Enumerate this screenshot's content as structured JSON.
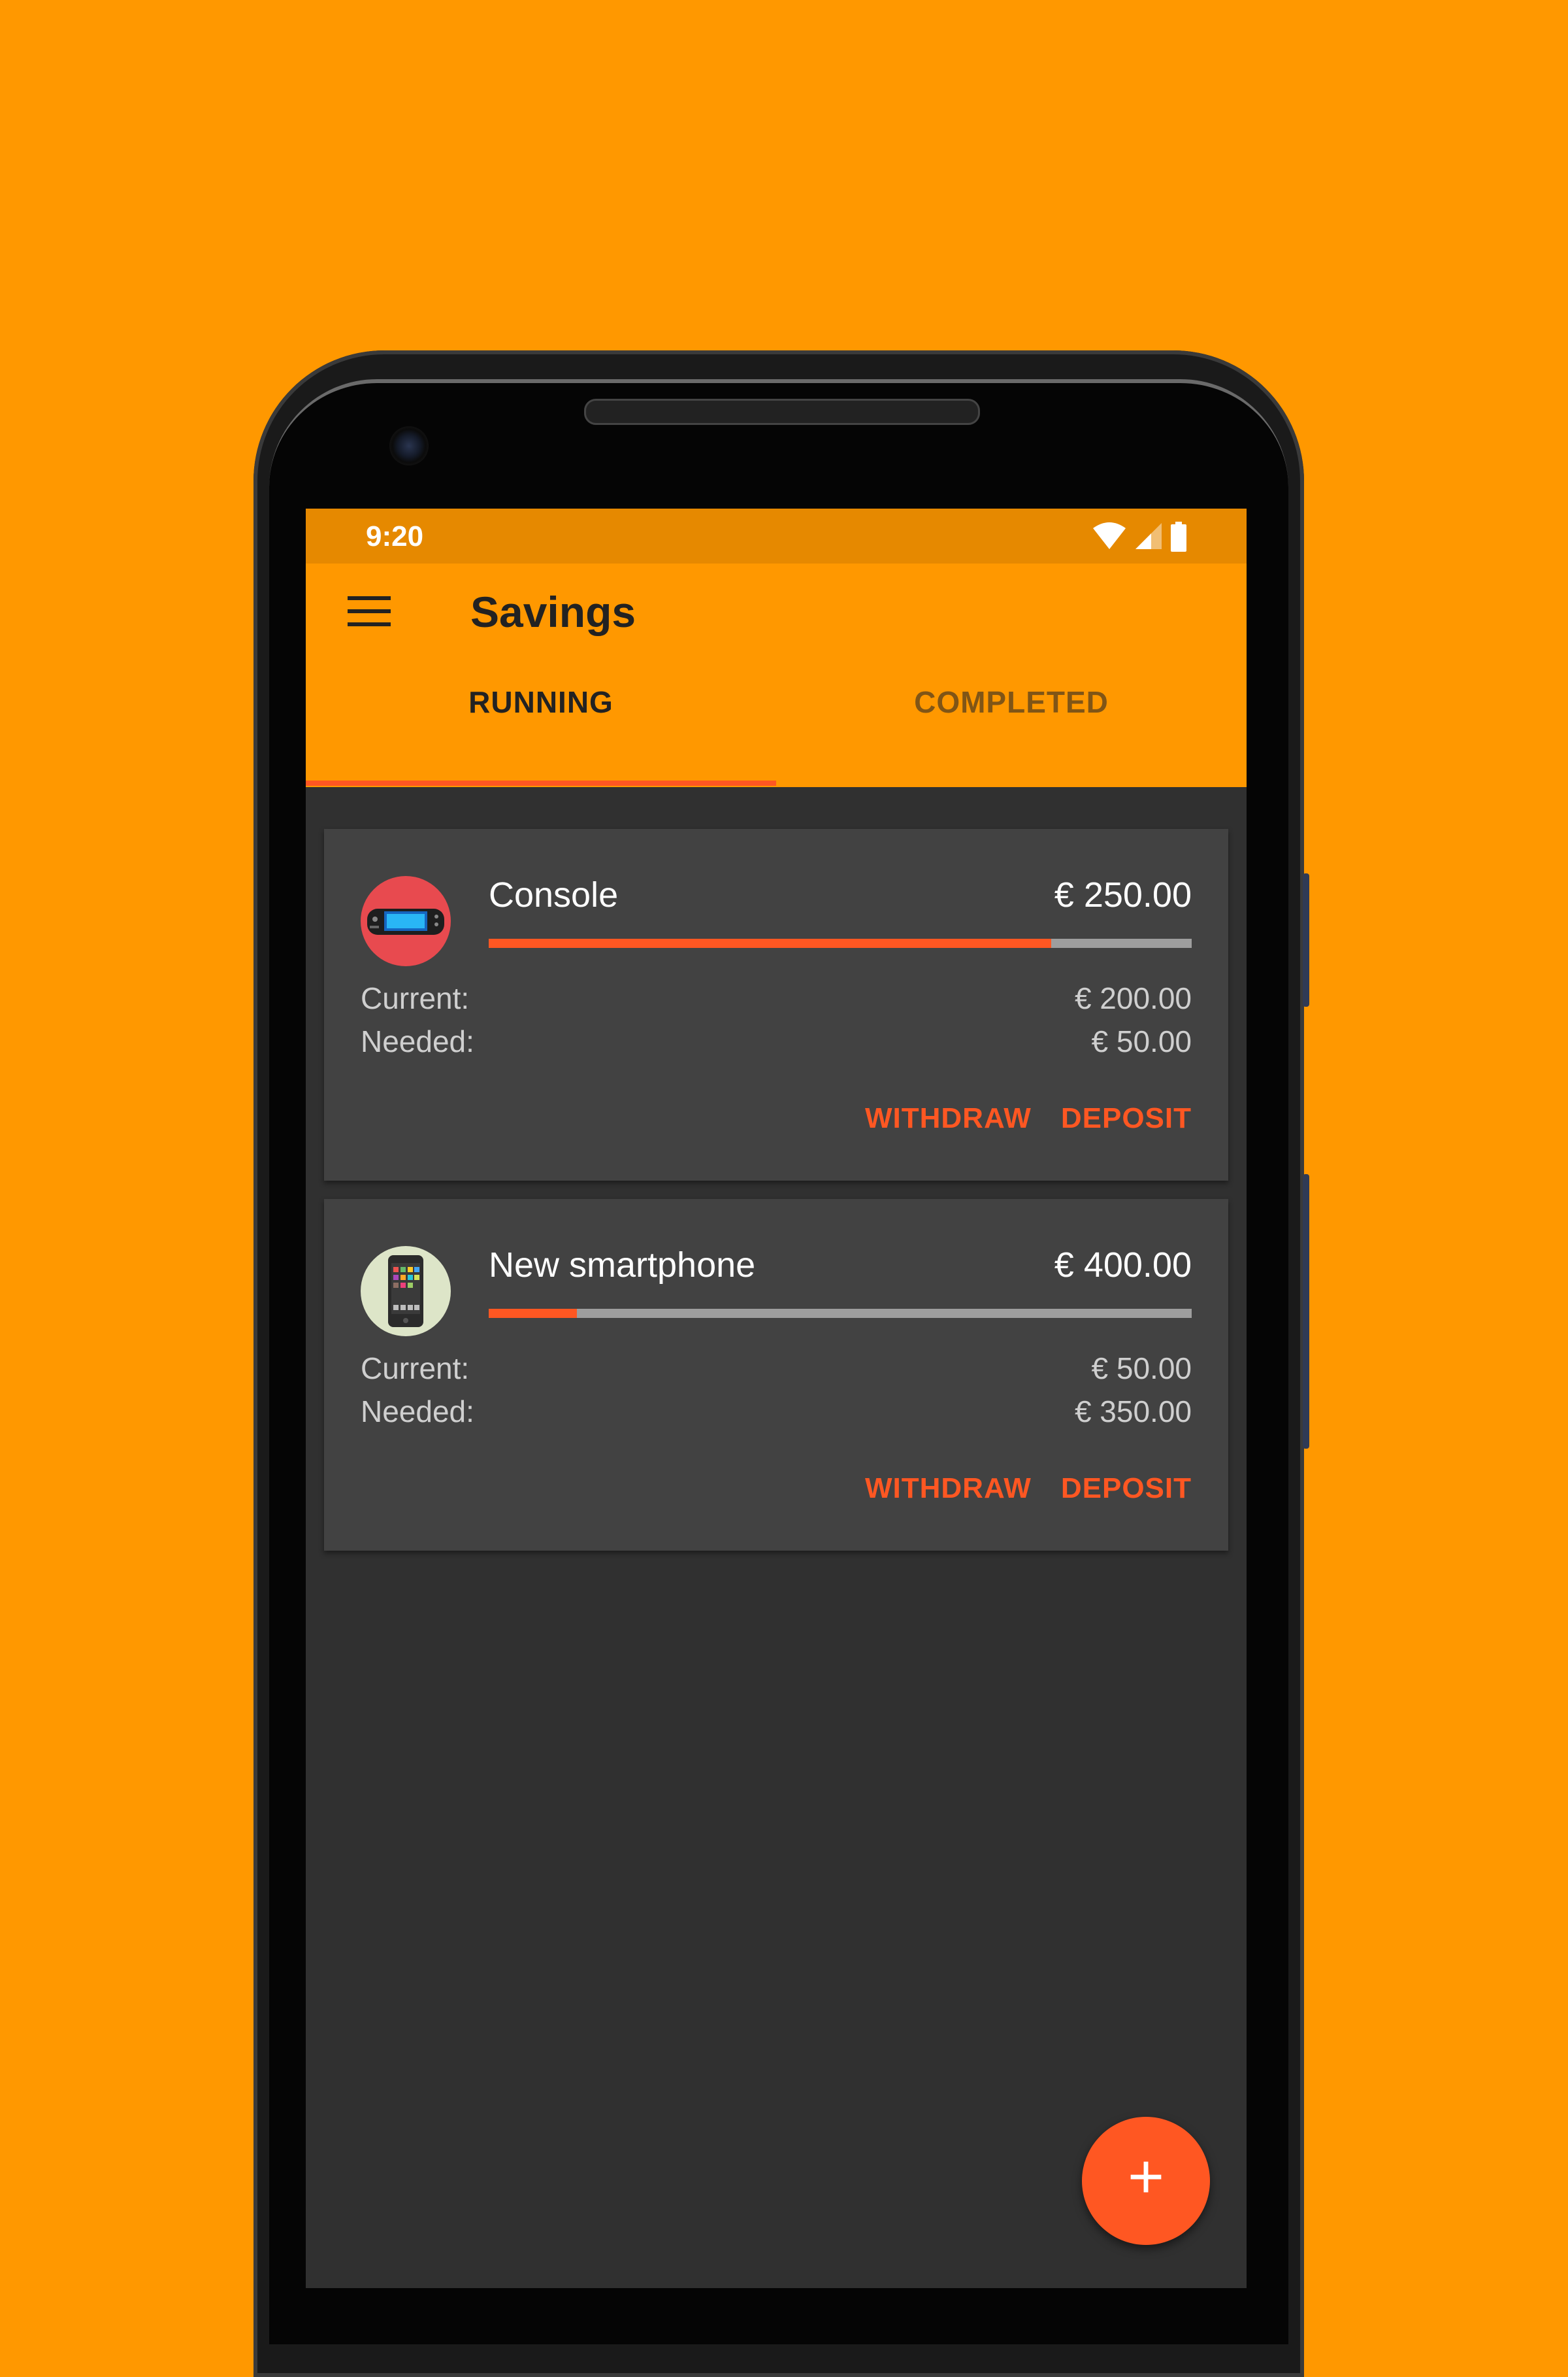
{
  "status_bar": {
    "time": "9:20"
  },
  "app_bar": {
    "title": "Savings",
    "menu_icon": "menu-icon"
  },
  "tabs": [
    {
      "label": "RUNNING",
      "selected": true
    },
    {
      "label": "COMPLETED",
      "selected": false
    }
  ],
  "goals": [
    {
      "name": "Console",
      "target": "€ 250.00",
      "icon": "game-console-icon",
      "icon_bg": "#E84A4F",
      "progress": 0.8,
      "current_label": "Current:",
      "current_value": "€ 200.00",
      "needed_label": "Needed:",
      "needed_value": "€ 50.00",
      "withdraw_label": "WITHDRAW",
      "deposit_label": "DEPOSIT"
    },
    {
      "name": "New smartphone",
      "target": "€ 400.00",
      "icon": "smartphone-icon",
      "icon_bg": "#DDE5C8",
      "progress": 0.125,
      "current_label": "Current:",
      "current_value": "€ 50.00",
      "needed_label": "Needed:",
      "needed_value": "€ 350.00",
      "withdraw_label": "WITHDRAW",
      "deposit_label": "DEPOSIT"
    }
  ],
  "fab": {
    "label": "+",
    "icon": "add-icon"
  },
  "colors": {
    "background": "#FF9800",
    "status_bar": "#E68900",
    "accent": "#FF5722",
    "card": "#424242",
    "screen": "#303030"
  }
}
